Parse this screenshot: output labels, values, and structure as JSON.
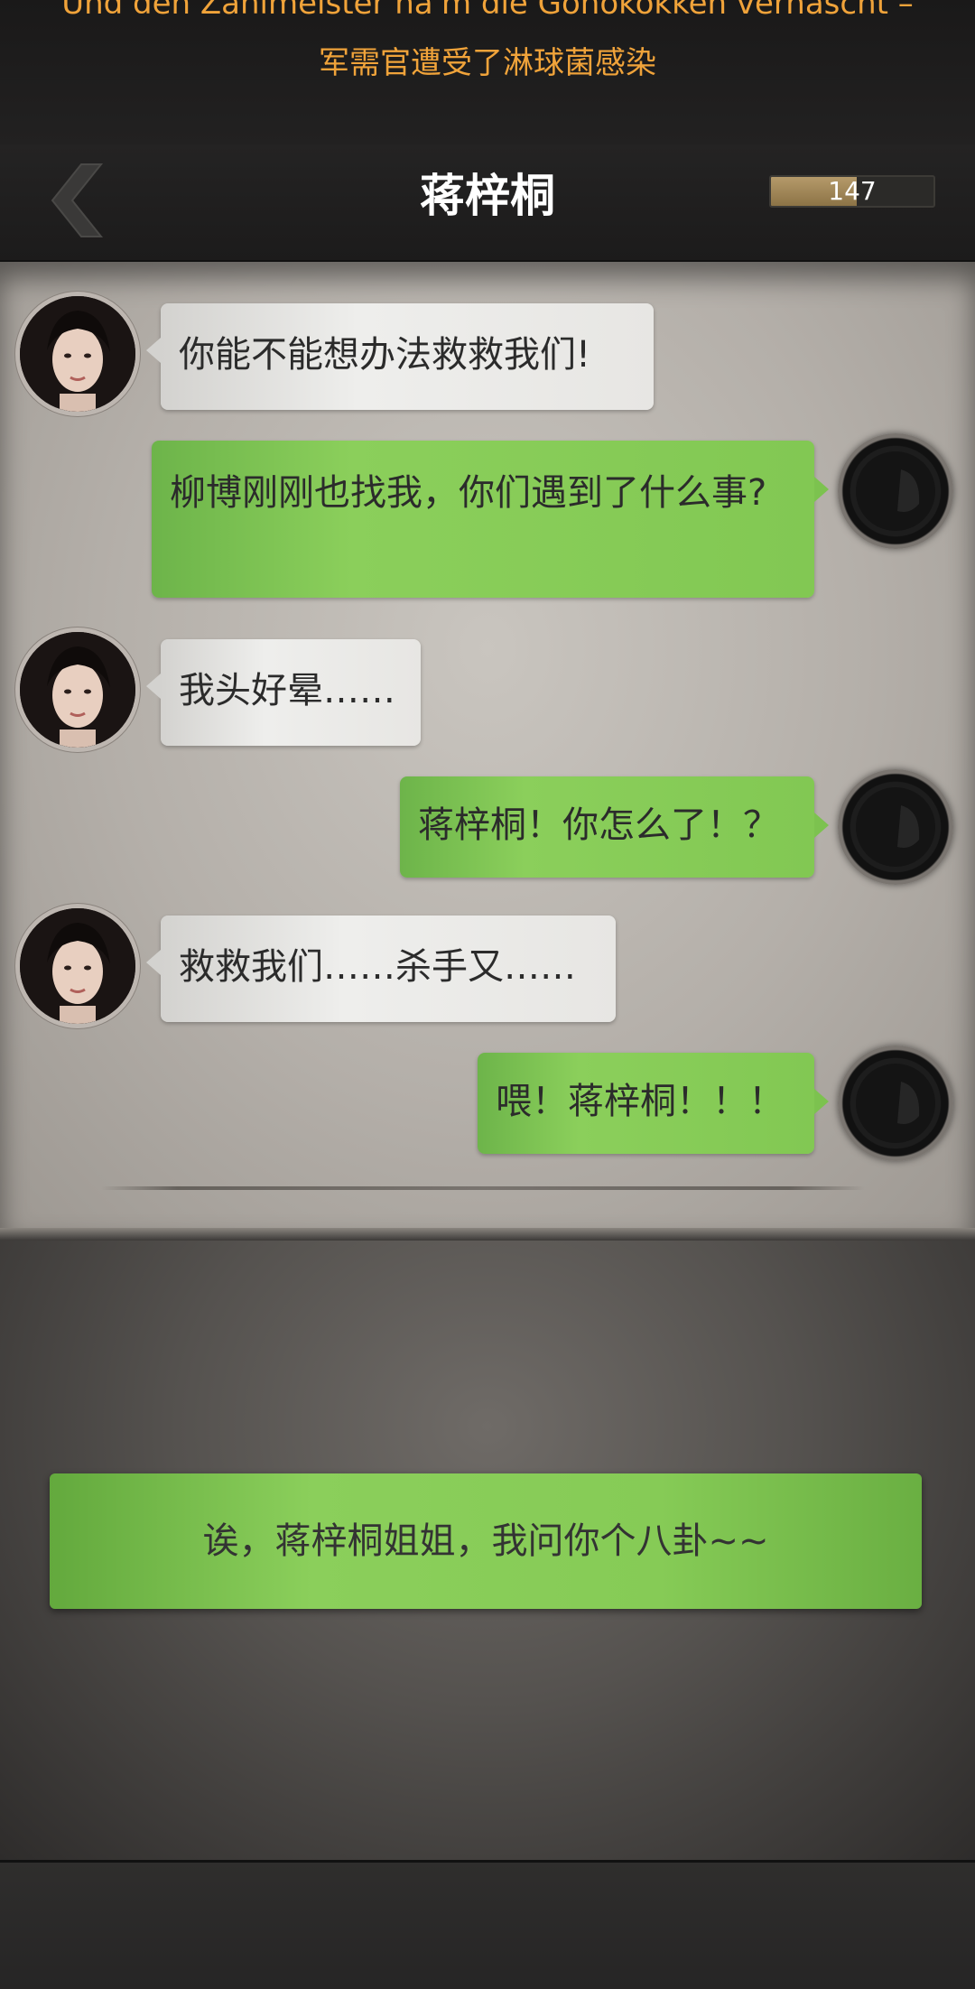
{
  "banner": {
    "subtitle_de": "Und den Zahlmeister ha'm die Gonokokken vernascht –",
    "subtitle_zh": "军需官遭受了淋球菌感染",
    "color": "#f0a33a"
  },
  "header": {
    "back_icon": "chevron-left-icon",
    "title": "蒋梓桐",
    "energy_value": "147",
    "energy_fill_fraction": 0.53
  },
  "messages": [
    {
      "sender": "her",
      "text": "你能不能想办法救救我们!"
    },
    {
      "sender": "me",
      "text": "柳博刚刚也找我，你们遇到了什么事?"
    },
    {
      "sender": "her",
      "text": "我头好晕……"
    },
    {
      "sender": "me",
      "text": "蒋梓桐！你怎么了！？"
    },
    {
      "sender": "her",
      "text": "救救我们……杀手又……"
    },
    {
      "sender": "me",
      "text": "喂！蒋梓桐！！！"
    }
  ],
  "choice": {
    "label": "诶，蒋梓桐姐姐，我问你个八卦~~"
  },
  "colors": {
    "green_bubble": "#8bcf5b",
    "white_bubble": "#eeeeec",
    "header_bg": "#1c1b1b"
  }
}
